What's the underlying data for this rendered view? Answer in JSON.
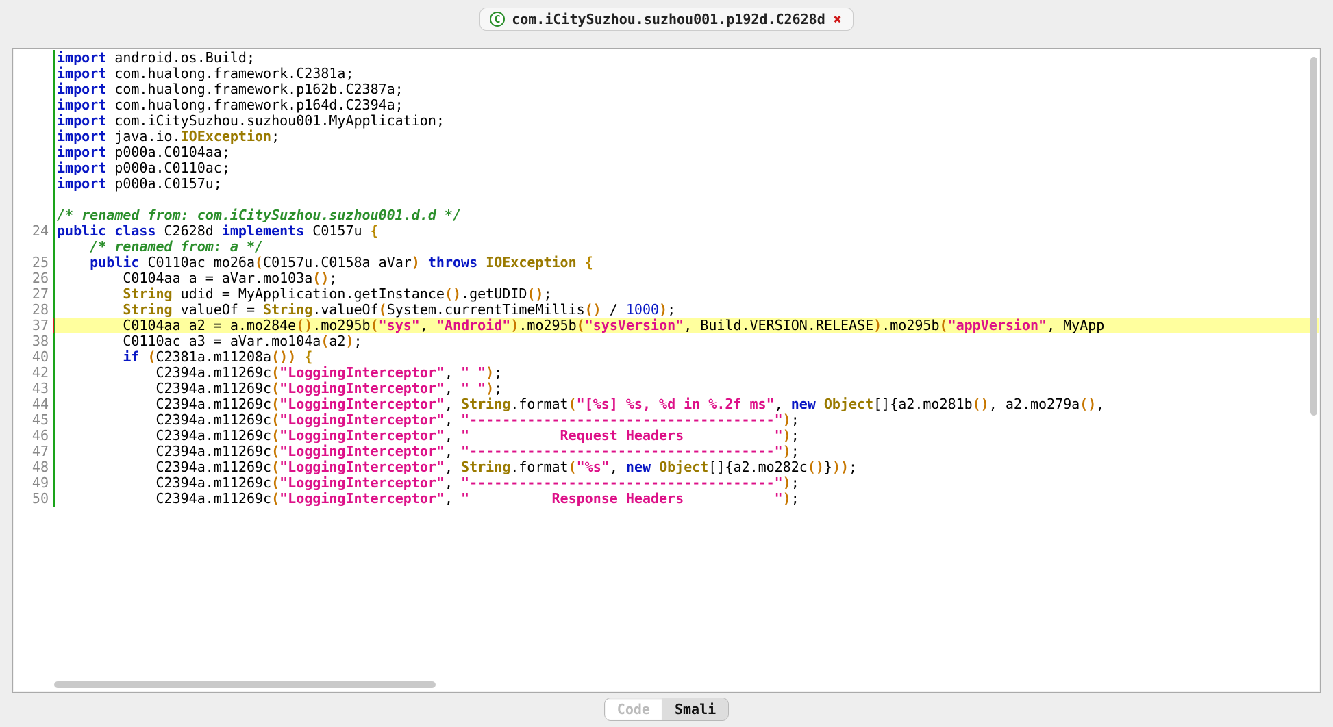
{
  "tab": {
    "title": "com.iCitySuzhou.suzhou001.p192d.C2628d",
    "type_badge": "C"
  },
  "bottom_toggle": {
    "left": "Code",
    "right": "Smali",
    "active": "Code"
  },
  "code": {
    "lines": [
      {
        "n": "",
        "segs": [
          [
            "kw",
            "import"
          ],
          [
            "plain",
            " android.os.Build;"
          ]
        ]
      },
      {
        "n": "",
        "segs": [
          [
            "kw",
            "import"
          ],
          [
            "plain",
            " com.hualong.framework.C2381a;"
          ]
        ]
      },
      {
        "n": "",
        "segs": [
          [
            "kw",
            "import"
          ],
          [
            "plain",
            " com.hualong.framework.p162b.C2387a;"
          ]
        ]
      },
      {
        "n": "",
        "segs": [
          [
            "kw",
            "import"
          ],
          [
            "plain",
            " com.hualong.framework.p164d.C2394a;"
          ]
        ]
      },
      {
        "n": "",
        "segs": [
          [
            "kw",
            "import"
          ],
          [
            "plain",
            " com.iCitySuzhou.suzhou001.MyApplication;"
          ]
        ]
      },
      {
        "n": "",
        "segs": [
          [
            "kw",
            "import"
          ],
          [
            "plain",
            " java.io."
          ],
          [
            "type",
            "IOException"
          ],
          [
            "plain",
            ";"
          ]
        ]
      },
      {
        "n": "",
        "segs": [
          [
            "kw",
            "import"
          ],
          [
            "plain",
            " p000a.C0104aa;"
          ]
        ]
      },
      {
        "n": "",
        "segs": [
          [
            "kw",
            "import"
          ],
          [
            "plain",
            " p000a.C0110ac;"
          ]
        ]
      },
      {
        "n": "",
        "segs": [
          [
            "kw",
            "import"
          ],
          [
            "plain",
            " p000a.C0157u;"
          ]
        ]
      },
      {
        "n": "",
        "segs": [
          [
            "plain",
            " "
          ]
        ]
      },
      {
        "n": "",
        "segs": [
          [
            "cmt",
            "/* renamed from: com.iCitySuzhou.suzhou001.d.d */"
          ]
        ]
      },
      {
        "n": "24",
        "segs": [
          [
            "kw",
            "public class"
          ],
          [
            "plain",
            " C2628d "
          ],
          [
            "kw",
            "implements"
          ],
          [
            "plain",
            " C0157u "
          ],
          [
            "brace",
            "{"
          ]
        ]
      },
      {
        "n": "",
        "segs": [
          [
            "plain",
            "    "
          ],
          [
            "cmt",
            "/* renamed from: a */"
          ]
        ]
      },
      {
        "n": "25",
        "segs": [
          [
            "plain",
            "    "
          ],
          [
            "kw",
            "public"
          ],
          [
            "plain",
            " C0110ac mo26a"
          ],
          [
            "paren",
            "("
          ],
          [
            "plain",
            "C0157u.C0158a aVar"
          ],
          [
            "paren",
            ")"
          ],
          [
            "plain",
            " "
          ],
          [
            "kw",
            "throws"
          ],
          [
            "plain",
            " "
          ],
          [
            "type",
            "IOException"
          ],
          [
            "plain",
            " "
          ],
          [
            "brace",
            "{"
          ]
        ]
      },
      {
        "n": "26",
        "segs": [
          [
            "plain",
            "        C0104aa a = aVar.mo103a"
          ],
          [
            "paren",
            "()"
          ],
          [
            "plain",
            ";"
          ]
        ]
      },
      {
        "n": "27",
        "segs": [
          [
            "plain",
            "        "
          ],
          [
            "type",
            "String"
          ],
          [
            "plain",
            " udid = MyApplication.getInstance"
          ],
          [
            "paren",
            "()"
          ],
          [
            "plain",
            ".getUDID"
          ],
          [
            "paren",
            "()"
          ],
          [
            "plain",
            ";"
          ]
        ]
      },
      {
        "n": "28",
        "segs": [
          [
            "plain",
            "        "
          ],
          [
            "type",
            "String"
          ],
          [
            "plain",
            " valueOf = "
          ],
          [
            "type",
            "String"
          ],
          [
            "plain",
            ".valueOf"
          ],
          [
            "paren",
            "("
          ],
          [
            "plain",
            "System.currentTimeMillis"
          ],
          [
            "paren",
            "()"
          ],
          [
            "plain",
            " / "
          ],
          [
            "num",
            "1000"
          ],
          [
            "paren",
            ")"
          ],
          [
            "plain",
            ";"
          ]
        ]
      },
      {
        "n": "37",
        "hl": true,
        "rededge": true,
        "segs": [
          [
            "plain",
            "        C0104aa a2 = a.mo284e"
          ],
          [
            "paren",
            "()"
          ],
          [
            "plain",
            ".mo295b"
          ],
          [
            "paren",
            "("
          ],
          [
            "str",
            "\"sys\""
          ],
          [
            "plain",
            ", "
          ],
          [
            "str",
            "\"Android\""
          ],
          [
            "paren",
            ")"
          ],
          [
            "plain",
            ".mo295b"
          ],
          [
            "paren",
            "("
          ],
          [
            "str",
            "\"sysVersion\""
          ],
          [
            "plain",
            ", Build.VERSION.RELEASE"
          ],
          [
            "paren",
            ")"
          ],
          [
            "plain",
            ".mo295b"
          ],
          [
            "paren",
            "("
          ],
          [
            "str",
            "\"appVersion\""
          ],
          [
            "plain",
            ", MyApp"
          ]
        ]
      },
      {
        "n": "38",
        "segs": [
          [
            "plain",
            "        C0110ac a3 = aVar.mo104a"
          ],
          [
            "paren",
            "("
          ],
          [
            "plain",
            "a2"
          ],
          [
            "paren",
            ")"
          ],
          [
            "plain",
            ";"
          ]
        ]
      },
      {
        "n": "40",
        "segs": [
          [
            "plain",
            "        "
          ],
          [
            "kw",
            "if"
          ],
          [
            "plain",
            " "
          ],
          [
            "paren",
            "("
          ],
          [
            "plain",
            "C2381a.m11208a"
          ],
          [
            "paren",
            "()"
          ],
          [
            "paren",
            ")"
          ],
          [
            "plain",
            " "
          ],
          [
            "brace",
            "{"
          ]
        ]
      },
      {
        "n": "42",
        "segs": [
          [
            "plain",
            "            C2394a.m11269c"
          ],
          [
            "paren",
            "("
          ],
          [
            "str",
            "\"LoggingInterceptor\""
          ],
          [
            "plain",
            ", "
          ],
          [
            "str",
            "\" \""
          ],
          [
            "paren",
            ")"
          ],
          [
            "plain",
            ";"
          ]
        ]
      },
      {
        "n": "43",
        "segs": [
          [
            "plain",
            "            C2394a.m11269c"
          ],
          [
            "paren",
            "("
          ],
          [
            "str",
            "\"LoggingInterceptor\""
          ],
          [
            "plain",
            ", "
          ],
          [
            "str",
            "\" \""
          ],
          [
            "paren",
            ")"
          ],
          [
            "plain",
            ";"
          ]
        ]
      },
      {
        "n": "44",
        "segs": [
          [
            "plain",
            "            C2394a.m11269c"
          ],
          [
            "paren",
            "("
          ],
          [
            "str",
            "\"LoggingInterceptor\""
          ],
          [
            "plain",
            ", "
          ],
          [
            "type",
            "String"
          ],
          [
            "plain",
            ".format"
          ],
          [
            "paren",
            "("
          ],
          [
            "str",
            "\"[%s] %s, %d in %.2f ms\""
          ],
          [
            "plain",
            ", "
          ],
          [
            "kw",
            "new"
          ],
          [
            "plain",
            " "
          ],
          [
            "type",
            "Object"
          ],
          [
            "plain",
            "[]{a2.mo281b"
          ],
          [
            "paren",
            "()"
          ],
          [
            "plain",
            ", a2.mo279a"
          ],
          [
            "paren",
            "()"
          ],
          [
            "plain",
            ","
          ]
        ]
      },
      {
        "n": "45",
        "segs": [
          [
            "plain",
            "            C2394a.m11269c"
          ],
          [
            "paren",
            "("
          ],
          [
            "str",
            "\"LoggingInterceptor\""
          ],
          [
            "plain",
            ", "
          ],
          [
            "str",
            "\"-------------------------------------\""
          ],
          [
            "paren",
            ")"
          ],
          [
            "plain",
            ";"
          ]
        ]
      },
      {
        "n": "46",
        "segs": [
          [
            "plain",
            "            C2394a.m11269c"
          ],
          [
            "paren",
            "("
          ],
          [
            "str",
            "\"LoggingInterceptor\""
          ],
          [
            "plain",
            ", "
          ],
          [
            "str",
            "\"           Request Headers           \""
          ],
          [
            "paren",
            ")"
          ],
          [
            "plain",
            ";"
          ]
        ]
      },
      {
        "n": "47",
        "segs": [
          [
            "plain",
            "            C2394a.m11269c"
          ],
          [
            "paren",
            "("
          ],
          [
            "str",
            "\"LoggingInterceptor\""
          ],
          [
            "plain",
            ", "
          ],
          [
            "str",
            "\"-------------------------------------\""
          ],
          [
            "paren",
            ")"
          ],
          [
            "plain",
            ";"
          ]
        ]
      },
      {
        "n": "48",
        "segs": [
          [
            "plain",
            "            C2394a.m11269c"
          ],
          [
            "paren",
            "("
          ],
          [
            "str",
            "\"LoggingInterceptor\""
          ],
          [
            "plain",
            ", "
          ],
          [
            "type",
            "String"
          ],
          [
            "plain",
            ".format"
          ],
          [
            "paren",
            "("
          ],
          [
            "str",
            "\"%s\""
          ],
          [
            "plain",
            ", "
          ],
          [
            "kw",
            "new"
          ],
          [
            "plain",
            " "
          ],
          [
            "type",
            "Object"
          ],
          [
            "plain",
            "[]{a2.mo282c"
          ],
          [
            "paren",
            "()"
          ],
          [
            "plain",
            "}"
          ],
          [
            "paren",
            ")"
          ],
          [
            "paren",
            ")"
          ],
          [
            "plain",
            ";"
          ]
        ]
      },
      {
        "n": "49",
        "segs": [
          [
            "plain",
            "            C2394a.m11269c"
          ],
          [
            "paren",
            "("
          ],
          [
            "str",
            "\"LoggingInterceptor\""
          ],
          [
            "plain",
            ", "
          ],
          [
            "str",
            "\"-------------------------------------\""
          ],
          [
            "paren",
            ")"
          ],
          [
            "plain",
            ";"
          ]
        ]
      },
      {
        "n": "50",
        "segs": [
          [
            "plain",
            "            C2394a.m11269c"
          ],
          [
            "paren",
            "("
          ],
          [
            "str",
            "\"LoggingInterceptor\""
          ],
          [
            "plain",
            ", "
          ],
          [
            "str",
            "\"          Response Headers           \""
          ],
          [
            "paren",
            ")"
          ],
          [
            "plain",
            ";"
          ]
        ]
      }
    ]
  }
}
